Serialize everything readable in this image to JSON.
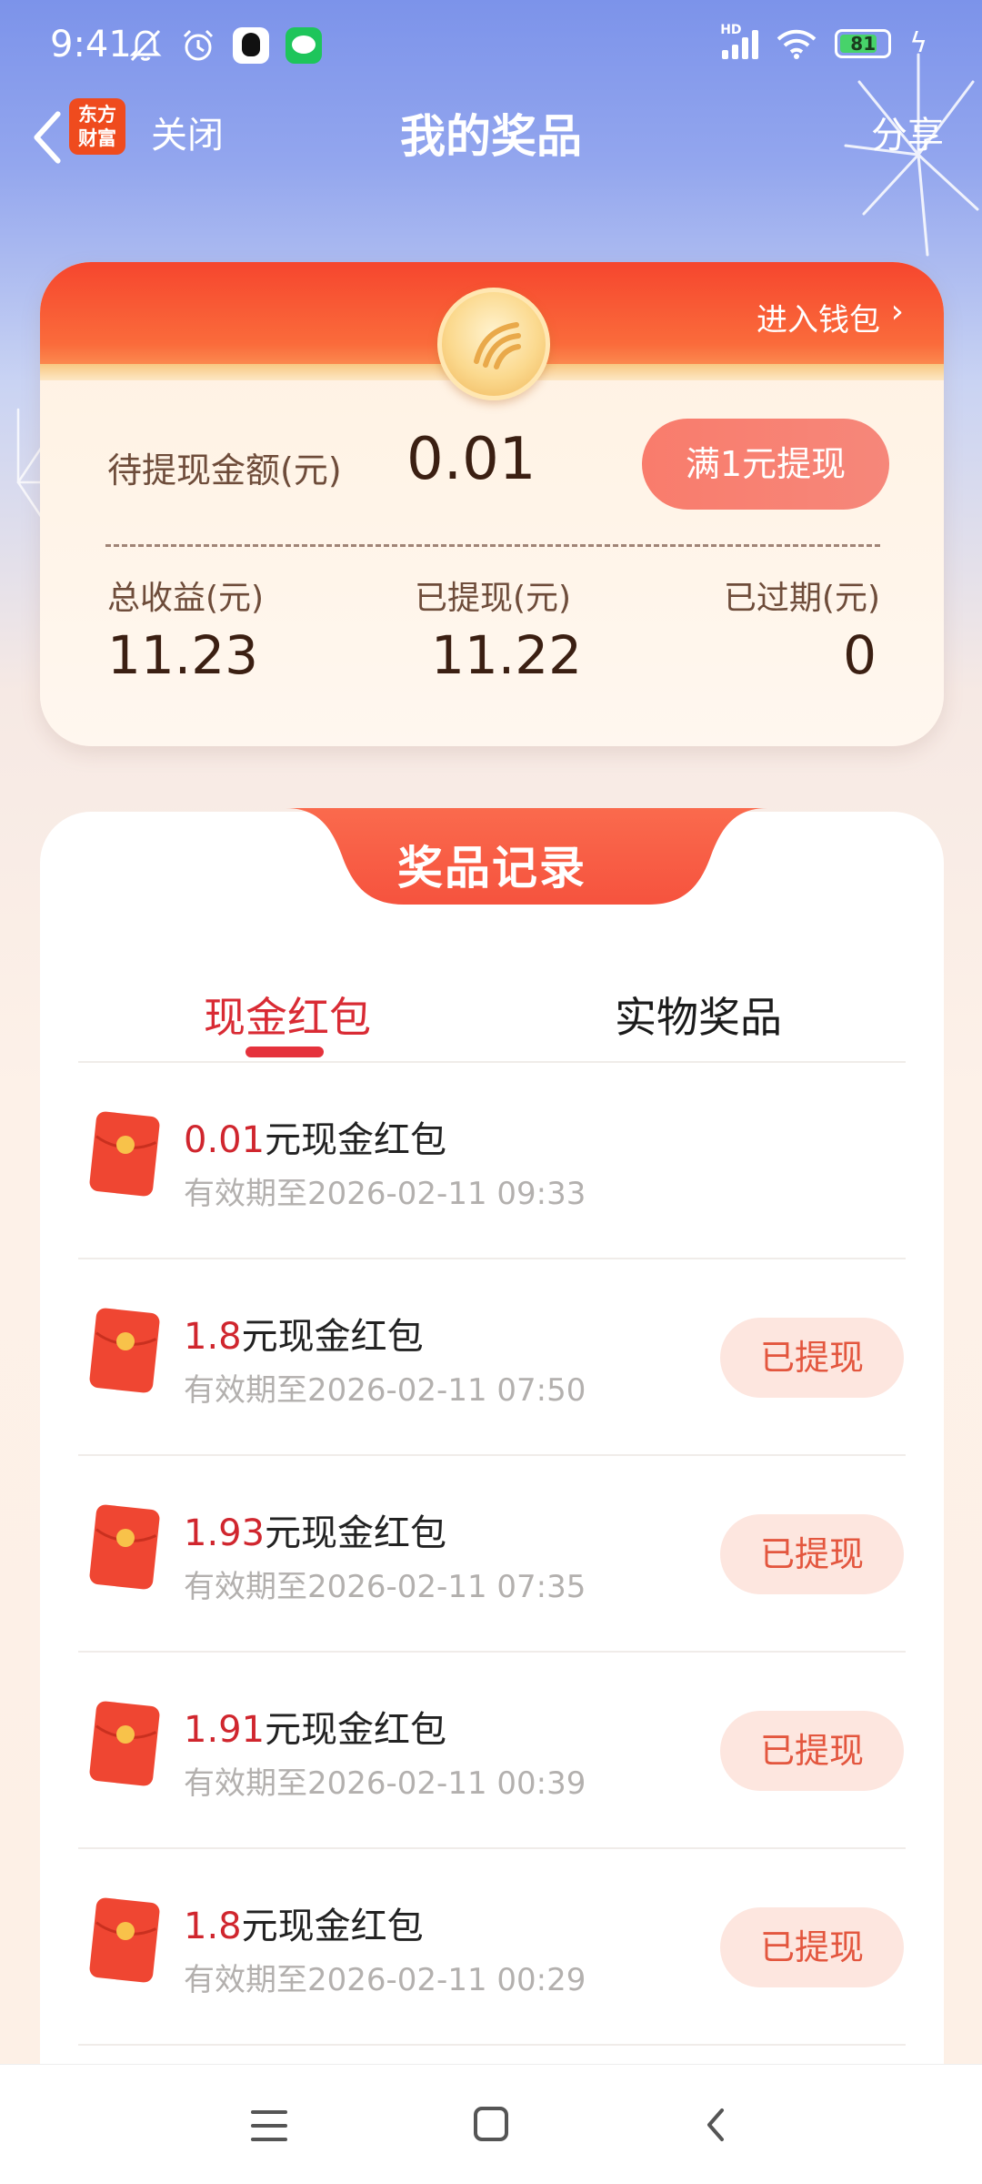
{
  "status_bar": {
    "time": "9:41",
    "battery_level": "81",
    "network_label": "HD"
  },
  "nav": {
    "app_logo_text": "东方财富",
    "close_label": "关闭",
    "title": "我的奖品",
    "share_label": "分享"
  },
  "wallet": {
    "enter_wallet_label": "进入钱包",
    "pending_label": "待提现金额(元)",
    "pending_amount": "0.01",
    "withdraw_button_label": "满1元提现",
    "stats": [
      {
        "label": "总收益(元)",
        "value": "11.23"
      },
      {
        "label": "已提现(元)",
        "value": "11.22"
      },
      {
        "label": "已过期(元)",
        "value": "0"
      }
    ]
  },
  "records": {
    "title": "奖品记录",
    "tabs": [
      {
        "label": "现金红包",
        "active": true
      },
      {
        "label": "实物奖品",
        "active": false
      }
    ],
    "items": [
      {
        "amount": "0.01",
        "suffix": "元现金红包",
        "expiry": "有效期至2026-02-11 09:33",
        "status": ""
      },
      {
        "amount": "1.8",
        "suffix": "元现金红包",
        "expiry": "有效期至2026-02-11 07:50",
        "status": "已提现"
      },
      {
        "amount": "1.93",
        "suffix": "元现金红包",
        "expiry": "有效期至2026-02-11 07:35",
        "status": "已提现"
      },
      {
        "amount": "1.91",
        "suffix": "元现金红包",
        "expiry": "有效期至2026-02-11 00:39",
        "status": "已提现"
      },
      {
        "amount": "1.8",
        "suffix": "元现金红包",
        "expiry": "有效期至2026-02-11 00:29",
        "status": "已提现"
      }
    ]
  },
  "colors": {
    "accent_red": "#d92b34",
    "header_orange": "#f6462e",
    "button_pink": "#f97c6c",
    "withdrawn_bg": "#fde6df"
  }
}
